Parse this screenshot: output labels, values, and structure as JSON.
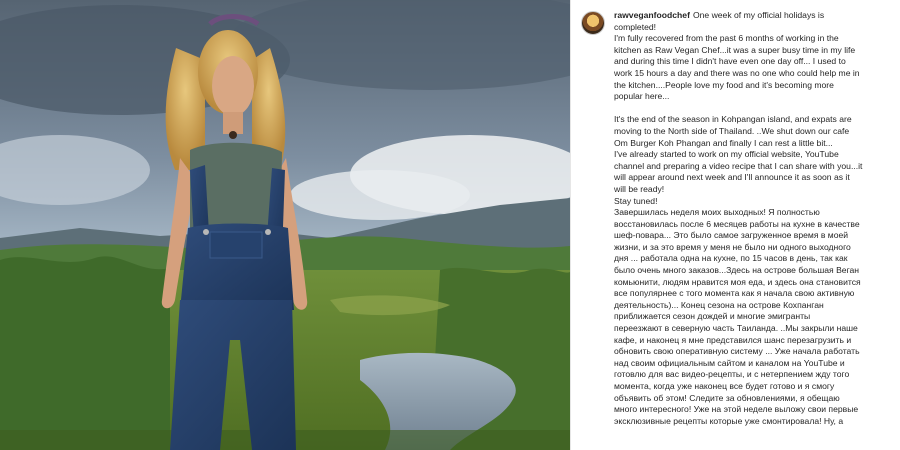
{
  "post": {
    "username": "rawveganfoodchef",
    "lines": [
      "One week of my official holidays is",
      "completed!",
      "I'm fully recovered from the past 6 months of working in the",
      "kitchen as Raw Vegan Chef...it was a super busy time in my life",
      "and during this time I didn't have even one day off... I used to",
      "work 15 hours a day and there was no one who could help me in",
      "the kitchen....People love my food and it's becoming more",
      "popular here...",
      "",
      "It's the end of the season in Kohpangan island, and expats are",
      "moving to the North side of Thailand. ..We shut down our cafe",
      "Om Burger Koh Phangan and finally I can rest a little bit...",
      "I've already started to work on my official website, YouTube",
      "channel and preparing a video recipe that I can share with you...it",
      "will appear around next week and I'll announce it as soon as it",
      "will be ready!",
      "Stay tuned!",
      "Завершилась неделя моих выходных! Я полностью",
      "восстановилась после 6 месяцев работы на кухне в качестве",
      "шеф-повара... Это было самое загруженное время в моей",
      "жизни, и за это время у меня не было ни одного выходного",
      "дня ... работала одна на кухне, по 15 часов в день, так как",
      "было очень много заказов...Здесь на острове большая Веган",
      "комьюнити, людям нравится моя еда, и здесь она становится",
      "все популярнее с того момента как я начала свою активную",
      "деятельность)... Конец сезона на острове Кохпанган",
      "приближается сезон дождей и многие эмигранты",
      "переезжают в северную часть Таиланда. ..Мы закрыли наше",
      "кафе, и наконец я мне представился шанс перезагрузить и",
      "обновить свою оперативную систему ... Уже начала работать",
      "над своим официальным сайтом и каналом на YouTube и",
      "готовлю для вас видео-рецепты, и с нетерпением жду того",
      "момента, когда уже наконец все будет готово и я смогу",
      "объявить об этом! Следите за обновлениями, я обещаю",
      "много интересного! Уже на этой неделе выложу свои первые",
      "эксклюзивные рецепты которые уже смонтировала! Ну, а"
    ]
  }
}
